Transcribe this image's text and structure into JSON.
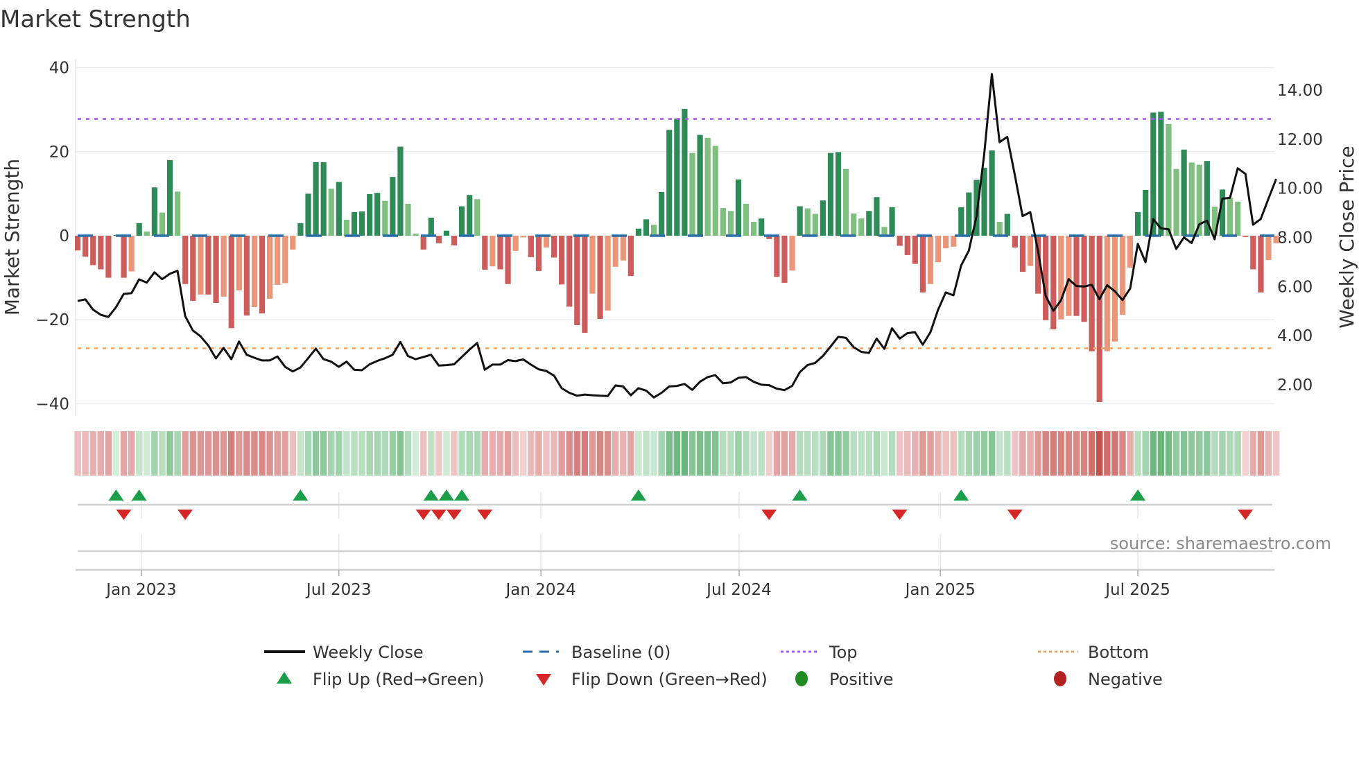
{
  "chart_data": {
    "type": "bar",
    "title": "Market Strength",
    "ylabel": "Market Strength",
    "y2label": "Weekly Close Price",
    "ylim": [
      -42,
      42
    ],
    "y2lim": [
      1.1,
      15.3
    ],
    "yticks": [
      40,
      20,
      0,
      -20,
      -40
    ],
    "ytick_labels": [
      "40",
      "20",
      "0",
      "−20",
      "−40"
    ],
    "y2ticks": [
      14,
      12,
      10,
      8,
      6,
      4,
      2
    ],
    "y2tick_labels": [
      "14.00",
      "12.00",
      "10.00",
      "8.00",
      "6.00",
      "4.00",
      "2.00"
    ],
    "x_unit": "week index",
    "xticks": [
      {
        "label": "Jan 2023",
        "week": 8.3
      },
      {
        "label": "Jul 2023",
        "week": 34.0
      },
      {
        "label": "Jan 2024",
        "week": 60.3
      },
      {
        "label": "Jul 2024",
        "week": 86.1
      },
      {
        "label": "Jan 2025",
        "week": 112.3
      },
      {
        "label": "Jul 2025",
        "week": 138.0
      }
    ],
    "top_level": 27.8,
    "bottom_level": -26.8,
    "baseline": 0,
    "strength": [
      -3.5,
      -5,
      -7,
      -8,
      -10,
      0.2,
      -10,
      -8.5,
      3,
      1,
      11.5,
      5.5,
      18,
      10.5,
      -11.5,
      -15.5,
      -14,
      -14,
      -16,
      -14.5,
      -22,
      -13,
      -19,
      -17,
      -18.5,
      -15,
      -11.7,
      -11.3,
      -3.3,
      3,
      10,
      17.5,
      17.5,
      11.2,
      12.8,
      3.8,
      5.6,
      5.8,
      9.9,
      10.2,
      8.3,
      14,
      21.2,
      7.6,
      0.5,
      -3.3,
      4.3,
      -1.8,
      1.2,
      -2.3,
      7,
      9.7,
      8.7,
      -8.1,
      -7.3,
      -8,
      -11.5,
      -3.6,
      -0.4,
      -5.1,
      -8.4,
      -2.8,
      -5.2,
      -11.6,
      -16.9,
      -21.3,
      -23.1,
      -13.8,
      -19.8,
      -17.8,
      -7.4,
      -5.9,
      -9.6,
      1.7,
      3.9,
      2.6,
      10.4,
      25.2,
      27.9,
      30.2,
      19.7,
      24,
      23.3,
      21.4,
      6.6,
      5.9,
      13.4,
      7.6,
      3.3,
      4.1,
      -0.8,
      -9.8,
      -11.2,
      -8.3,
      7,
      6.5,
      5.2,
      8.4,
      19.7,
      19.9,
      15.9,
      5.3,
      4.1,
      5.9,
      9.2,
      2.1,
      6.8,
      -2.4,
      -4.6,
      -6.7,
      -13.5,
      -11.5,
      -6.3,
      -3,
      -2.6,
      6.8,
      10.3,
      13.3,
      16.2,
      20.3,
      3.3,
      5.2,
      -2.8,
      -8.6,
      -7.2,
      -13.8,
      -20.1,
      -22.3,
      -19.9,
      -19.1,
      -19.1,
      -20.5,
      -27.5,
      -39.6,
      -27.5,
      -25.2,
      -18.8,
      -7.6,
      5.6,
      10.9,
      29.3,
      29.5,
      26.6,
      15.9,
      20.5,
      17.4,
      16.9,
      17.8,
      6.9,
      11,
      9,
      8.1,
      -0.3,
      -8,
      -13.5,
      -5.8,
      -1.8
    ],
    "weekly_close": [
      5.41,
      5.48,
      5.06,
      4.85,
      4.76,
      5.16,
      5.7,
      5.73,
      6.29,
      6.16,
      6.58,
      6.3,
      6.52,
      6.64,
      4.79,
      4.21,
      3.97,
      3.6,
      3.07,
      3.5,
      3.04,
      3.76,
      3.22,
      3.1,
      2.99,
      2.99,
      3.15,
      2.73,
      2.54,
      2.7,
      3.08,
      3.47,
      3.04,
      2.94,
      2.73,
      2.94,
      2.61,
      2.59,
      2.83,
      2.97,
      3.08,
      3.22,
      3.74,
      3.17,
      3.04,
      3.13,
      3.22,
      2.78,
      2.8,
      2.83,
      3.13,
      3.43,
      3.7,
      2.61,
      2.82,
      2.82,
      3.0,
      2.96,
      3.03,
      2.82,
      2.63,
      2.56,
      2.37,
      1.86,
      1.67,
      1.55,
      1.6,
      1.57,
      1.55,
      1.54,
      1.97,
      1.93,
      1.57,
      1.86,
      1.76,
      1.48,
      1.67,
      1.93,
      1.95,
      2.03,
      1.79,
      2.12,
      2.31,
      2.39,
      2.06,
      2.09,
      2.28,
      2.31,
      2.12,
      2.0,
      1.98,
      1.84,
      1.78,
      1.95,
      2.51,
      2.8,
      2.89,
      3.17,
      3.55,
      3.95,
      3.91,
      3.53,
      3.34,
      3.29,
      3.88,
      3.46,
      4.3,
      3.88,
      4.1,
      4.14,
      3.63,
      4.14,
      5.06,
      5.76,
      5.64,
      6.86,
      7.46,
      8.87,
      11.37,
      14.66,
      11.88,
      12.1,
      10.52,
      8.87,
      9.03,
      7.46,
      5.62,
      5.01,
      5.44,
      6.3,
      6.02,
      6.0,
      6.07,
      5.48,
      6.05,
      5.81,
      5.45,
      5.92,
      7.74,
      6.99,
      8.75,
      8.37,
      8.33,
      7.53,
      8.0,
      7.77,
      8.54,
      8.68,
      7.93,
      9.58,
      9.62,
      10.82,
      10.59,
      8.52,
      8.75,
      9.58,
      10.38
    ],
    "flip_up_weeks": [
      5,
      8,
      29,
      46,
      48,
      50,
      73,
      94,
      115,
      138
    ],
    "flip_down_weeks": [
      6,
      14,
      45,
      47,
      49,
      53,
      90,
      107,
      122,
      152
    ],
    "legend_position": "bottom",
    "grid": true
  },
  "legend": {
    "weekly_close": "Weekly Close",
    "baseline": "Baseline (0)",
    "top": "Top",
    "bottom": "Bottom",
    "flip_up": "Flip Up (Red→Green)",
    "flip_down": "Flip Down (Green→Red)",
    "positive": "Positive",
    "negative": "Negative"
  },
  "source": "source: sharemaestro.com",
  "colors": {
    "pos_dark": "#2e8b57",
    "pos_light": "#7fbf7f",
    "neg_dark": "#cd5c5c",
    "neg_light": "#e9967a",
    "baseline": "#2a6fa8",
    "top": "#a35cf0",
    "bottom": "#f4a460",
    "close": "#111111",
    "flip_up": "#1a9e4a",
    "flip_down": "#d62728",
    "positive": "#228b22",
    "negative": "#b22222"
  }
}
